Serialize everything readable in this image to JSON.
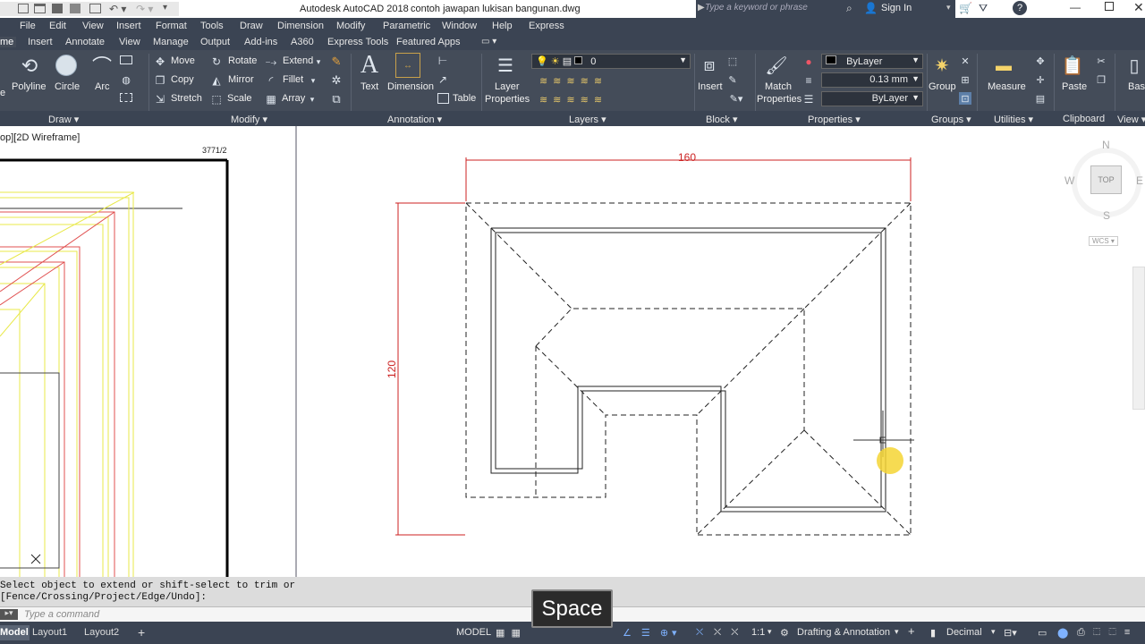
{
  "title_bar": {
    "app_title": "Autodesk AutoCAD 2018",
    "file_name": "contoh jawapan lukisan bangunan.dwg",
    "search_placeholder": "Type a keyword or phrase",
    "sign_in": "Sign In"
  },
  "menu": [
    "File",
    "Edit",
    "View",
    "Insert",
    "Format",
    "Tools",
    "Draw",
    "Dimension",
    "Modify",
    "Parametric",
    "Window",
    "Help",
    "Express"
  ],
  "ribbon_tabs": {
    "active": "me",
    "items": [
      "Insert",
      "Annotate",
      "View",
      "Manage",
      "Output",
      "Add-ins",
      "A360",
      "Express Tools",
      "Featured Apps"
    ]
  },
  "ribbon": {
    "draw": {
      "polyline": "Polyline",
      "circle": "Circle",
      "arc": "Arc",
      "line_partial": "e"
    },
    "modify": {
      "move": "Move",
      "rotate": "Rotate",
      "extend": "Extend",
      "copy": "Copy",
      "mirror": "Mirror",
      "fillet": "Fillet",
      "stretch": "Stretch",
      "scale": "Scale",
      "array": "Array"
    },
    "annotation": {
      "text": "Text",
      "dimension": "Dimension",
      "table": "Table"
    },
    "layers": {
      "layer_properties_1": "Layer",
      "layer_properties_2": "Properties",
      "current_layer": "0"
    },
    "block": {
      "insert": "Insert"
    },
    "properties": {
      "match_1": "Match",
      "match_2": "Properties",
      "color": "ByLayer",
      "lineweight": "0.13 mm",
      "linetype": "ByLayer"
    },
    "groups": {
      "group": "Group"
    },
    "utilities": {
      "measure": "Measure"
    },
    "clipboard": {
      "paste": "Paste"
    },
    "base": {
      "base": "Base"
    },
    "panels": [
      "Draw",
      "Modify",
      "Annotation",
      "Layers",
      "Block",
      "Properties",
      "Groups",
      "Utilities",
      "Clipboard",
      "View"
    ]
  },
  "viewport_left": {
    "label": "op][2D Wireframe]",
    "corner_text": "3771/2"
  },
  "drawing": {
    "dim_top": "160",
    "dim_left": "120"
  },
  "viewcube": {
    "n": "N",
    "s": "S",
    "w": "W",
    "e": "E",
    "top": "TOP",
    "wcs": "WCS"
  },
  "command": {
    "line1": "Select object to extend or shift-select to trim or",
    "line2": "[Fence/Crossing/Project/Edge/Undo]:",
    "placeholder": "Type a command"
  },
  "status": {
    "tabs": [
      "Model",
      "Layout1",
      "Layout2"
    ],
    "model": "MODEL",
    "scale": "1:1",
    "workspace": "Drafting & Annotation",
    "units": "Decimal"
  },
  "overlay_key": "Space",
  "colors": {
    "dimension": "#cc2222",
    "dark_panel": "#444c59"
  }
}
